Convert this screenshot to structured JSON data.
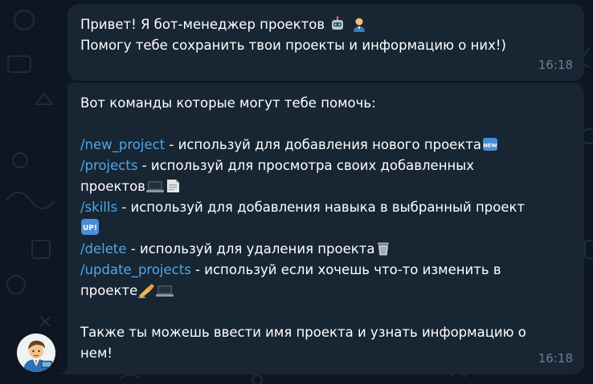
{
  "messages": [
    {
      "lines": [
        {
          "text": "Привет! Я бот-менеджер проектов",
          "emojis": [
            "robot-icon",
            "office-worker-icon"
          ]
        },
        {
          "text": "Помогу тебе сохранить твои проекты и информацию о них!)"
        }
      ],
      "time": "16:18"
    },
    {
      "intro": "Вот команды которые могут тебе помочь:",
      "commands": [
        {
          "cmd": "/new_project",
          "desc": " - используй для добавления нового проекта",
          "emoji": "new-badge-icon"
        },
        {
          "cmd": "/projects",
          "desc": " - используй для просмотра своих добавленных",
          "desc2": "проектов",
          "emoji": "laptop-page-icon"
        },
        {
          "cmd": "/skills",
          "desc": " - используй для добавления навыка в выбранный проект",
          "emoji": "up-badge-icon"
        },
        {
          "cmd": "/delete",
          "desc": " - используй для удаления проекта",
          "emoji": "trash-icon"
        },
        {
          "cmd": "/update_projects",
          "desc": " - используй если хочешь что-то изменить в",
          "desc2": "проекте",
          "emoji": "writing-hand-laptop-icon"
        }
      ],
      "outro1": "Также ты можешь ввести имя проекта и узнать информацию о",
      "outro2": "нем!",
      "time": "16:18"
    }
  ],
  "colors": {
    "background": "#0e1621",
    "bubble": "#182533",
    "command_link": "#4fa8e8",
    "time": "#6d7f8f"
  }
}
